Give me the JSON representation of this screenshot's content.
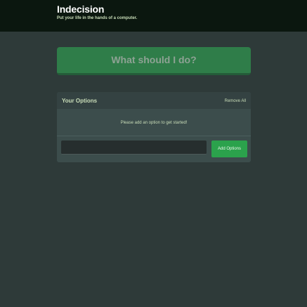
{
  "header": {
    "title": "Indecision",
    "subtitle": "Put your life in the hands of a computer."
  },
  "main": {
    "action_label": "What should I do?"
  },
  "options": {
    "title": "Your Options",
    "remove_all_label": "Remove All",
    "empty_message": "Please add an option to get started!",
    "input_value": "",
    "input_placeholder": "",
    "add_label": "Add Options"
  },
  "colors": {
    "background": "#2e3a39",
    "header_background": "#0b170f",
    "primary_button": "#2f7d49",
    "add_button": "#2ba24c",
    "panel_background": "#3c4d4c",
    "text_light": "#c9ddb8"
  }
}
